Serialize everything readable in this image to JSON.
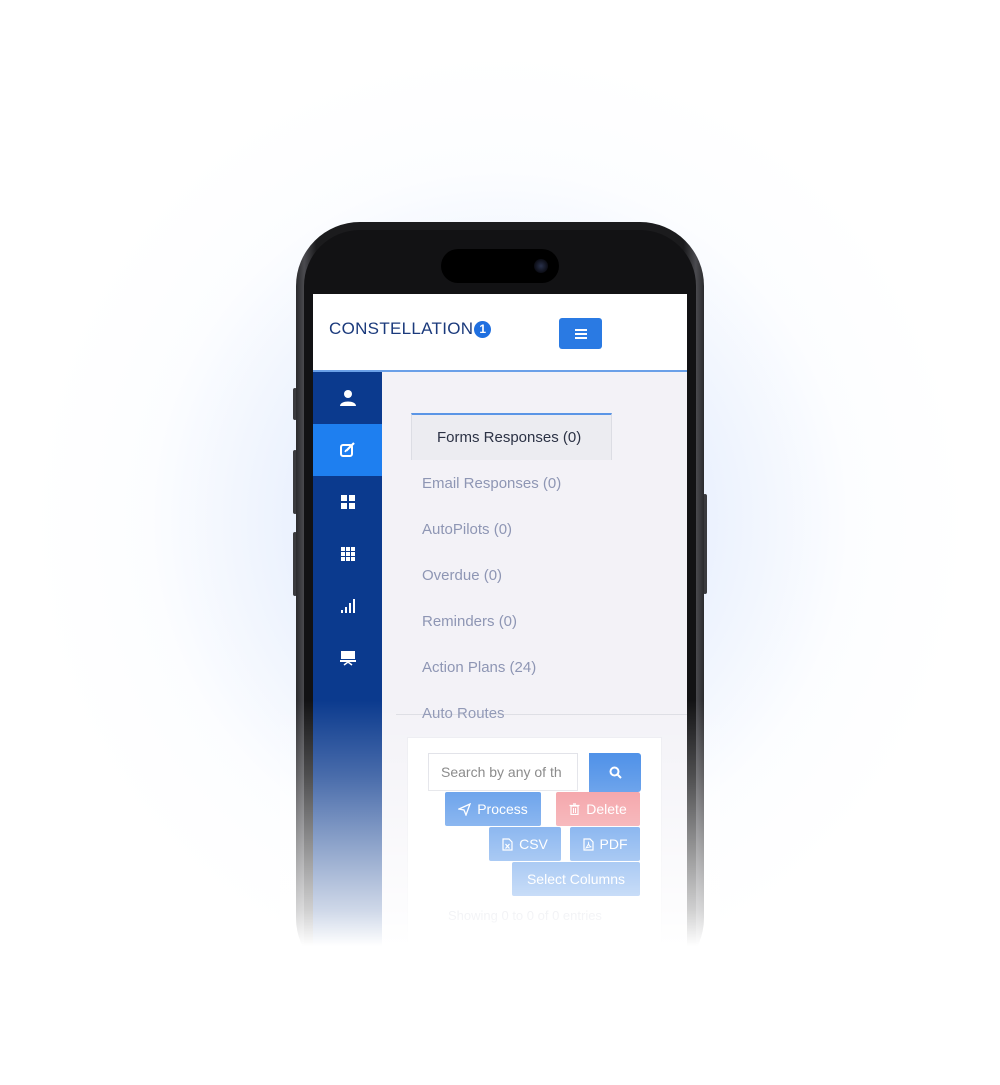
{
  "brand": {
    "name": "CONSTELLATION",
    "badge": "1"
  },
  "header": {
    "menu_icon": "hamburger-icon"
  },
  "sidebar": {
    "items": [
      {
        "icon": "user-icon",
        "active": false
      },
      {
        "icon": "edit-icon",
        "active": true
      },
      {
        "icon": "dashboard-icon",
        "active": false
      },
      {
        "icon": "apps-grid-icon",
        "active": false
      },
      {
        "icon": "signal-bars-icon",
        "active": false
      },
      {
        "icon": "presentation-icon",
        "active": false
      }
    ]
  },
  "tabs": [
    {
      "label": "Forms Responses (0)"
    },
    {
      "label": "Email Responses (0)"
    },
    {
      "label": "AutoPilots (0)"
    },
    {
      "label": "Overdue (0)"
    },
    {
      "label": "Reminders (0)"
    },
    {
      "label": "Action Plans (24)"
    },
    {
      "label": "Auto Routes"
    }
  ],
  "table": {
    "search_placeholder": "Search by any of th",
    "process_label": "Process",
    "delete_label": "Delete",
    "csv_label": "CSV",
    "pdf_label": "PDF",
    "select_columns_label": "Select Columns",
    "info_text": "Showing 0 to 0 of 0 entries"
  },
  "colors": {
    "primary": "#2a7ae3",
    "sidebar": "#0b3a8e",
    "sidebar_active": "#1e7ff0",
    "danger": "#f07f86",
    "brand": "#1b3a7c"
  }
}
